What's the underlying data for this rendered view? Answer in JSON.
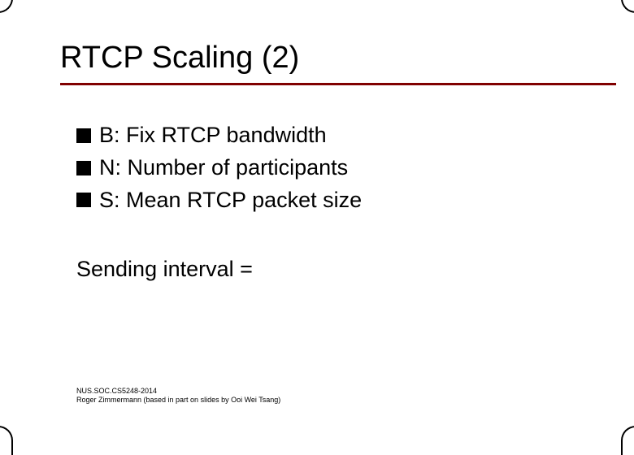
{
  "slide": {
    "title": "RTCP Scaling (2)",
    "accent_color": "#800000",
    "bullets": [
      {
        "text": "B: Fix RTCP bandwidth"
      },
      {
        "text": "N: Number of participants"
      },
      {
        "text": "S: Mean RTCP packet size"
      }
    ],
    "interval_line": "Sending interval =",
    "footer": {
      "line1": "NUS.SOC.CS5248-2014",
      "line2": "Roger Zimmermann (based in part on slides by Ooi Wei Tsang)"
    }
  }
}
